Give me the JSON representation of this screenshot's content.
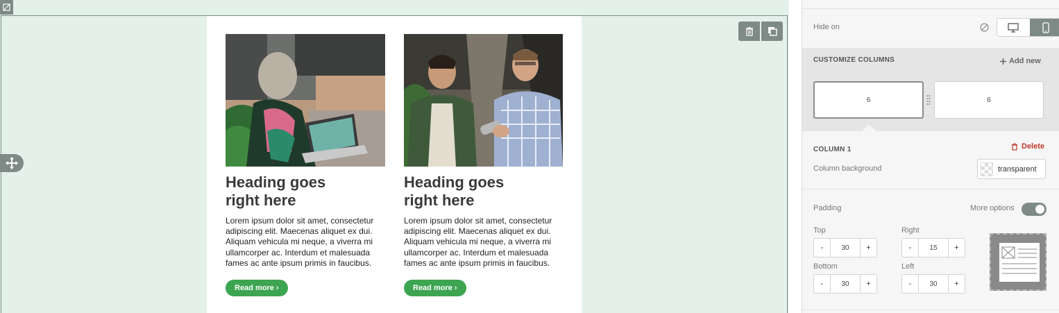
{
  "email": {
    "columns": [
      {
        "image_alt": "Woman with braided hair using a laptop among plants",
        "heading_line1": "Heading goes",
        "heading_line2": "right here",
        "body": "Lorem ipsum dolor sit amet, consectetur adipiscing elit. Maecenas aliquet ex dui. Aliquam vehicula mi neque, a viverra mi ullamcorper ac. Interdum et malesuada fames ac ante ipsum primis in faucibus.",
        "button": "Read more ›"
      },
      {
        "image_alt": "Two men talking in an office, one holding a bottle",
        "heading_line1": "Heading goes",
        "heading_line2": "right here",
        "body": "Lorem ipsum dolor sit amet, consectetur adipiscing elit. Maecenas aliquet ex dui. Aliquam vehicula mi neque, a viverra mi ullamcorper ac. Interdum et malesuada fames ac ante ipsum primis in faucibus.",
        "button": "Read more ›"
      }
    ]
  },
  "row_actions": {
    "delete_icon": "trash-icon",
    "duplicate_icon": "duplicate-icon",
    "move_icon": "move-icon"
  },
  "panel": {
    "hide_on_label": "Hide on",
    "devices": [
      {
        "name": "desktop",
        "icon": "monitor-icon",
        "active": false
      },
      {
        "name": "mobile",
        "icon": "mobile-icon",
        "active": true
      }
    ],
    "customize_title": "CUSTOMIZE COLUMNS",
    "add_new": "Add new",
    "column_widths": [
      "6",
      "6"
    ],
    "column_title": "COLUMN 1",
    "delete": "Delete",
    "bg_label": "Column background",
    "bg_value": "transparent",
    "padding_label": "Padding",
    "more_options_label": "More options",
    "more_options_on": true,
    "padding": {
      "top_label": "Top",
      "top": "30",
      "right_label": "Right",
      "right": "15",
      "bottom_label": "Bottom",
      "bottom": "30",
      "left_label": "Left",
      "left": "30"
    },
    "stepper_minus": "-",
    "stepper_plus": "+"
  },
  "colors": {
    "canvas_bg": "#e3f1ea",
    "button_green": "#3da451",
    "delete_red": "#c0392b",
    "tool_grey": "#7e8a86"
  }
}
